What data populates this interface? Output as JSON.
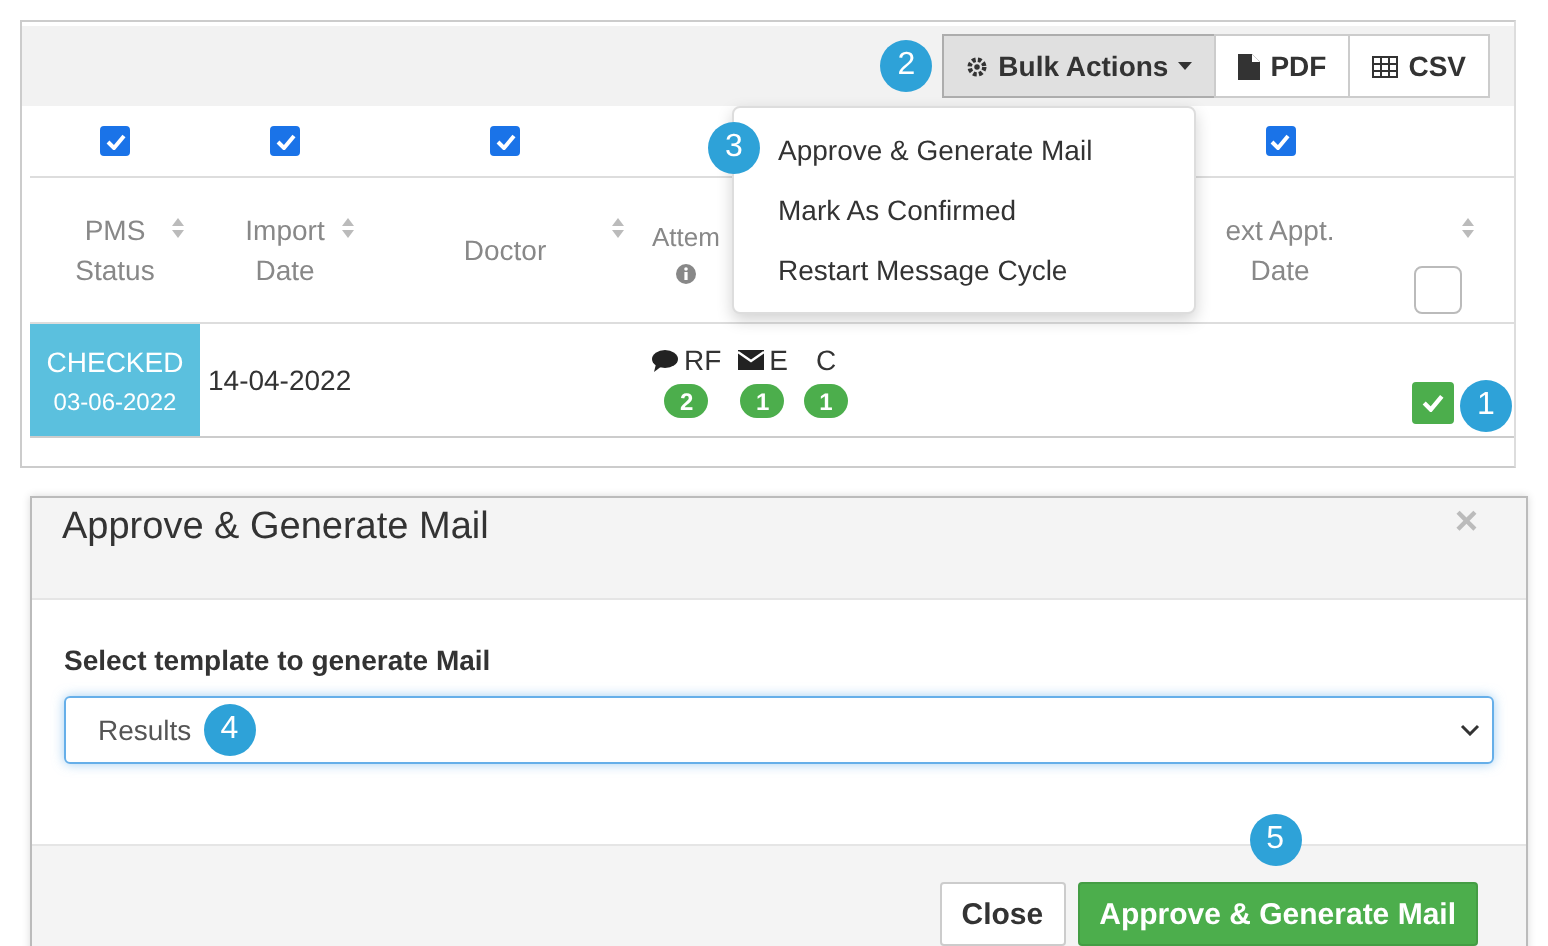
{
  "toolbar": {
    "callout": "2",
    "buttons": [
      {
        "kind": "bulk",
        "label": "Bulk Actions",
        "selected": true
      },
      {
        "kind": "pdf",
        "label": "PDF",
        "selected": false
      },
      {
        "kind": "csv",
        "label": "CSV",
        "selected": false
      }
    ]
  },
  "bulk_menu": {
    "callout": "3",
    "items": [
      "Approve & Generate Mail",
      "Mark As Confirmed",
      "Restart Message Cycle"
    ]
  },
  "columns": [
    {
      "title": "PMS Status",
      "sortable": true,
      "filter": {
        "checked": true
      }
    },
    {
      "title": "Import Date",
      "sortable": true,
      "filter": {
        "checked": true
      }
    },
    {
      "title": "Doctor",
      "sortable": true,
      "filter": {
        "checked": true
      }
    },
    {
      "title": "Attem",
      "info": true
    },
    {},
    {
      "title": "ext Appt. Date",
      "filter": {
        "checked": true
      }
    },
    {
      "sortable": true,
      "select_all": {
        "checked": false
      }
    }
  ],
  "rows": [
    {
      "status": {
        "label": "CHECKED",
        "date": "03-06-2022"
      },
      "import_date": "14-04-2022",
      "messages": [
        {
          "kind": "chat",
          "label": "RF",
          "count": "2"
        },
        {
          "kind": "mail",
          "label": "E",
          "count": "1"
        },
        {
          "kind": "plain",
          "label": "C",
          "count": "1"
        }
      ],
      "selected": true,
      "callout": "1"
    }
  ],
  "modal": {
    "title": "Approve & Generate Mail",
    "close": "×",
    "field_label": "Select template to generate Mail",
    "template": "Results",
    "template_callout": "4",
    "buttons": [
      {
        "kind": "default",
        "label": "Close"
      },
      {
        "kind": "primary",
        "label": "Approve & Generate Mail",
        "callout": "5"
      }
    ]
  }
}
